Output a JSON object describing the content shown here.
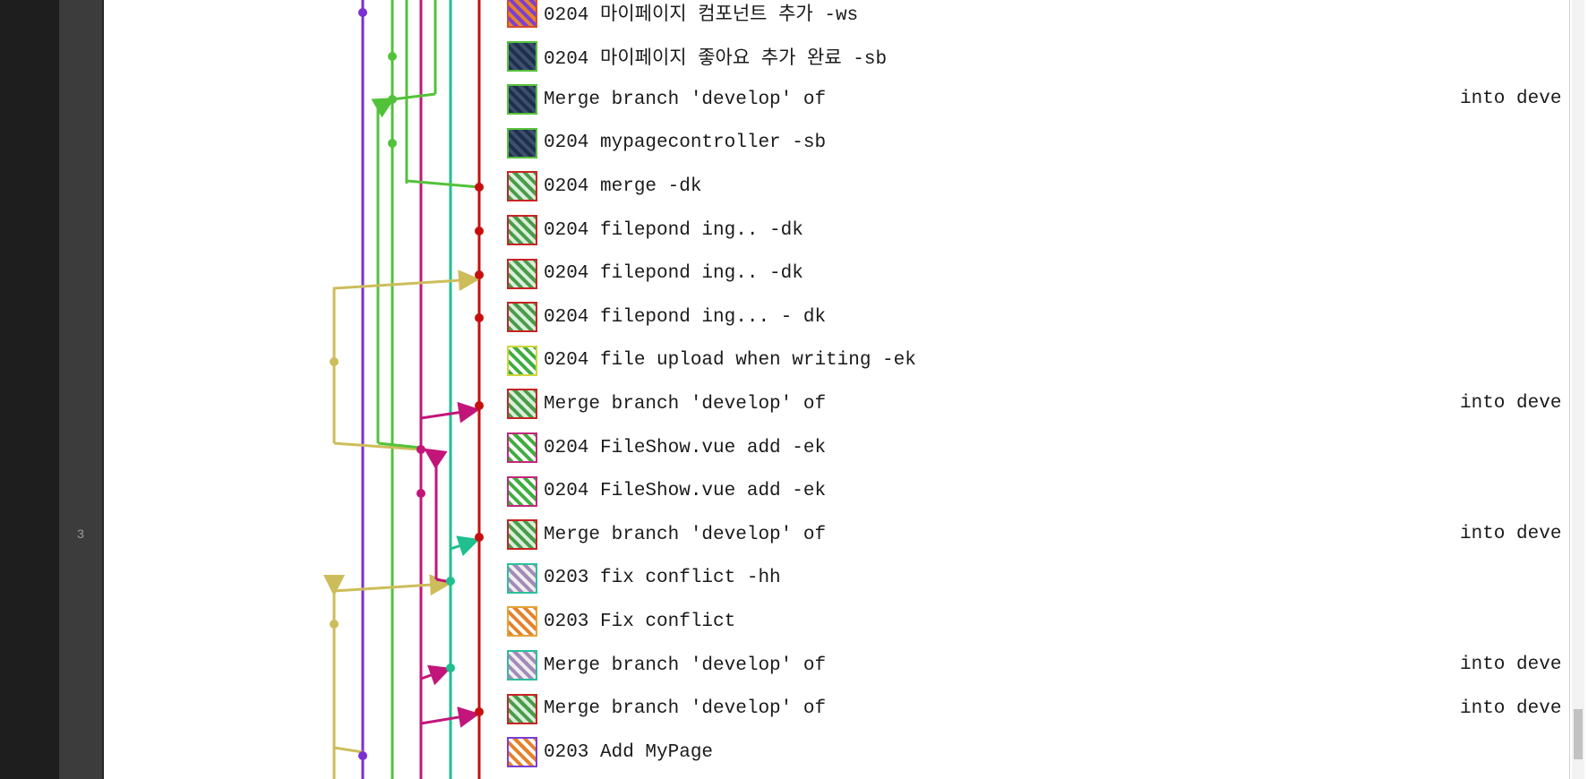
{
  "editor": {
    "line_number": "3"
  },
  "commits": [
    {
      "message": "0204 마이페이지 컴포넌트 추가 -ws",
      "avatar": "orange-pattern-avatar",
      "border": "#d84a2a",
      "c1": "#e5822c",
      "c2": "#7b3fd6",
      "trail": ""
    },
    {
      "message": "0204 마이페이지 좋아요 추가 완료 -sb",
      "avatar": "space-photo-avatar",
      "border": "#55c23a",
      "c1": "#1d2f4d",
      "c2": "#3e4f6e",
      "trail": ""
    },
    {
      "message": "Merge branch 'develop' of",
      "avatar": "space-photo-avatar",
      "border": "#55c23a",
      "c1": "#1d2f4d",
      "c2": "#3e4f6e",
      "trail": "into deve"
    },
    {
      "message": "0204 mypagecontroller -sb",
      "avatar": "space-photo-avatar",
      "border": "#55c23a",
      "c1": "#1d2f4d",
      "c2": "#3e4f6e",
      "trail": ""
    },
    {
      "message": "0204 merge -dk",
      "avatar": "green-pattern-avatar",
      "border": "#c82424",
      "c1": "#4a9c4a",
      "c2": "#d9efd9",
      "trail": ""
    },
    {
      "message": "0204 filepond ing.. -dk",
      "avatar": "green-pattern-avatar",
      "border": "#c82424",
      "c1": "#4a9c4a",
      "c2": "#d9efd9",
      "trail": ""
    },
    {
      "message": "0204 filepond ing.. -dk",
      "avatar": "green-pattern-avatar",
      "border": "#c82424",
      "c1": "#4a9c4a",
      "c2": "#d9efd9",
      "trail": ""
    },
    {
      "message": "0204 filepond ing... - dk",
      "avatar": "green-pattern-avatar",
      "border": "#c82424",
      "c1": "#4a9c4a",
      "c2": "#d9efd9",
      "trail": ""
    },
    {
      "message": "0204 file upload when writing -ek",
      "avatar": "lime-pattern-avatar",
      "border": "#cfd63a",
      "c1": "#3fae3f",
      "c2": "#ffffff",
      "trail": ""
    },
    {
      "message": "Merge branch 'develop' of",
      "avatar": "green-pattern-avatar",
      "border": "#c82424",
      "c1": "#4a9c4a",
      "c2": "#d9efd9",
      "trail": "into deve"
    },
    {
      "message": "0204 FileShow.vue add -ek",
      "avatar": "lime-pattern-avatar",
      "border": "#c2287a",
      "c1": "#3fae3f",
      "c2": "#ffffff",
      "trail": ""
    },
    {
      "message": "0204 FileShow.vue add -ek",
      "avatar": "lime-pattern-avatar",
      "border": "#c2287a",
      "c1": "#3fae3f",
      "c2": "#ffffff",
      "trail": ""
    },
    {
      "message": "Merge branch 'develop' of",
      "avatar": "green-pattern-avatar",
      "border": "#c82424",
      "c1": "#4a9c4a",
      "c2": "#d9efd9",
      "trail": "into deve"
    },
    {
      "message": "0203 fix conflict -hh",
      "avatar": "lavender-pattern-avatar",
      "border": "#2cbf9b",
      "c1": "#a48ab8",
      "c2": "#eeeeee",
      "trail": ""
    },
    {
      "message": "0203 Fix conflict",
      "avatar": "orange-pattern-avatar",
      "border": "#e6a23a",
      "c1": "#e5822c",
      "c2": "#ffffff",
      "trail": ""
    },
    {
      "message": "Merge branch 'develop' of ",
      "avatar": "lavender-pattern-avatar",
      "border": "#2cbf9b",
      "c1": "#a48ab8",
      "c2": "#eeeeee",
      "trail": "into deve"
    },
    {
      "message": "Merge branch 'develop' of ",
      "avatar": "green-pattern-avatar",
      "border": "#c82424",
      "c1": "#4a9c4a",
      "c2": "#d9efd9",
      "trail": "into deve"
    },
    {
      "message": "0203 Add MyPage",
      "avatar": "orange-pattern-avatar",
      "border": "#7b3fd6",
      "c1": "#e5822c",
      "c2": "#ffffff",
      "trail": ""
    }
  ],
  "graph_colors": {
    "purple": "#7a2fd0",
    "green": "#52c23a",
    "magenta": "#c2157a",
    "teal": "#1fbf8f",
    "red": "#c80f0f",
    "olive": "#cdbd5a"
  }
}
